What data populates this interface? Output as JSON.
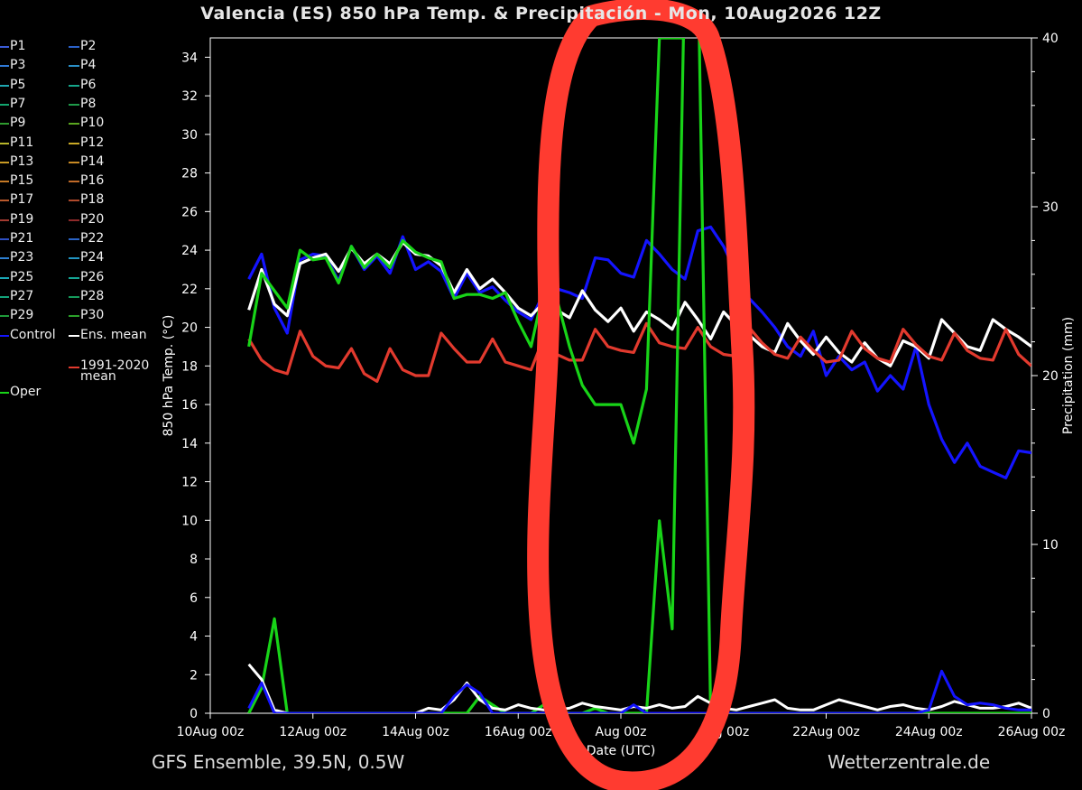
{
  "title": "Valencia  (ES)  850 hPa Temp. & Precipitación - Mon, 10Aug2026 12Z",
  "footer_left": "GFS Ensemble, 39.5N, 0.5W",
  "footer_right": "Wetterzentrale.de",
  "legend": [
    {
      "label": "P1",
      "color": "#3b5bd6"
    },
    {
      "label": "P2",
      "color": "#2b61c8"
    },
    {
      "label": "P3",
      "color": "#2f7ad8"
    },
    {
      "label": "P4",
      "color": "#2a8fc7"
    },
    {
      "label": "P5",
      "color": "#1fa6b0"
    },
    {
      "label": "P6",
      "color": "#16a58a"
    },
    {
      "label": "P7",
      "color": "#12a56e"
    },
    {
      "label": "P8",
      "color": "#1f9a4a"
    },
    {
      "label": "P9",
      "color": "#2f9b2f"
    },
    {
      "label": "P10",
      "color": "#5aa51f"
    },
    {
      "label": "P11",
      "color": "#b7b52a"
    },
    {
      "label": "P12",
      "color": "#c9a926"
    },
    {
      "label": "P13",
      "color": "#c89a24"
    },
    {
      "label": "P14",
      "color": "#c88a24"
    },
    {
      "label": "P15",
      "color": "#c57a26"
    },
    {
      "label": "P16",
      "color": "#c06a28"
    },
    {
      "label": "P17",
      "color": "#b9592c"
    },
    {
      "label": "P18",
      "color": "#b04a2c"
    },
    {
      "label": "P19",
      "color": "#a23a30"
    },
    {
      "label": "P20",
      "color": "#8e2a2a"
    },
    {
      "label": "P21",
      "color": "#2e4fc2"
    },
    {
      "label": "P22",
      "color": "#2a64c6"
    },
    {
      "label": "P23",
      "color": "#2d7fd0"
    },
    {
      "label": "P24",
      "color": "#2295c2"
    },
    {
      "label": "P25",
      "color": "#1aa7b6"
    },
    {
      "label": "P26",
      "color": "#15a595"
    },
    {
      "label": "P27",
      "color": "#13a37a"
    },
    {
      "label": "P28",
      "color": "#159a5c"
    },
    {
      "label": "P29",
      "color": "#1f9a3a"
    },
    {
      "label": "P30",
      "color": "#2ba12a"
    },
    {
      "label": "Control",
      "color": "#1414ff"
    },
    {
      "label": "Ens. mean",
      "color": "#ffffff"
    },
    {
      "label": "1991-2020",
      "label2": "mean",
      "color": "#e23a2e"
    },
    {
      "label": "Oper",
      "color": "#18d418"
    }
  ],
  "annotation": {
    "color": "#ff3b30"
  },
  "chart_data": {
    "type": "line",
    "title": "Valencia  (ES)  850 hPa Temp. & Precipitación - Mon, 10Aug2026 12Z",
    "xlabel": "Date (UTC)",
    "ylabel": "850 hPa Temp. (°C)",
    "y2label": "Precipitation (mm)",
    "ylim": [
      0,
      35
    ],
    "y2lim": [
      0,
      40
    ],
    "y_ticks": [
      0,
      2,
      4,
      6,
      8,
      10,
      12,
      14,
      16,
      18,
      20,
      22,
      24,
      26,
      28,
      30,
      32,
      34
    ],
    "y2_ticks": [
      0,
      10,
      20,
      30,
      40
    ],
    "x_ticks": [
      {
        "label": "10Aug 00z",
        "day": 0
      },
      {
        "label": "12Aug 00z",
        "day": 2
      },
      {
        "label": "14Aug 00z",
        "day": 4
      },
      {
        "label": "16Aug 00z",
        "day": 6
      },
      {
        "label": "Aug 00z",
        "day": 8
      },
      {
        "label": "Aug 00z",
        "day": 10
      },
      {
        "label": "22Aug 00z",
        "day": 12
      },
      {
        "label": "24Aug 00z",
        "day": 14
      },
      {
        "label": "26Aug 00z",
        "day": 16
      }
    ],
    "xlim": [
      0,
      16
    ],
    "x_days": [
      0.75,
      1.0,
      1.25,
      1.5,
      1.75,
      2.0,
      2.25,
      2.5,
      2.75,
      3.0,
      3.25,
      3.5,
      3.75,
      4.0,
      4.25,
      4.5,
      4.75,
      5.0,
      5.25,
      5.5,
      5.75,
      6.0,
      6.25,
      6.5,
      6.75,
      7.0,
      7.25,
      7.5,
      7.75,
      8.0,
      8.25,
      8.5,
      8.75,
      9.0,
      9.25,
      9.5,
      9.75,
      10.0,
      10.25,
      10.5,
      10.75,
      11.0,
      11.25,
      11.5,
      11.75,
      12.0,
      12.25,
      12.5,
      12.75,
      13.0,
      13.25,
      13.5,
      13.75,
      14.0,
      14.25,
      14.5,
      14.75,
      15.0,
      15.25,
      15.5,
      15.75,
      16.0
    ],
    "series": [
      {
        "name": "Control",
        "kind": "temp",
        "color": "#1414ff",
        "width": 3.2,
        "values": [
          22.5,
          23.8,
          21.0,
          19.7,
          23.5,
          23.8,
          23.7,
          22.4,
          24.2,
          23.0,
          23.7,
          22.8,
          24.7,
          23.0,
          23.4,
          22.9,
          21.5,
          22.8,
          21.8,
          22.1,
          21.4,
          20.8,
          20.4,
          21.8,
          22.0,
          21.8,
          21.5,
          23.6,
          23.5,
          22.8,
          22.6,
          24.5,
          23.8,
          23.0,
          22.5,
          25.0,
          25.2,
          24.2,
          22.8,
          21.5,
          20.8,
          20.0,
          19.0,
          18.5,
          19.8,
          17.5,
          18.5,
          17.8,
          18.2,
          16.7,
          17.5,
          16.8,
          19.0,
          16.0,
          14.2,
          13.0,
          14.0,
          12.8,
          12.5,
          12.2,
          13.6,
          13.5,
          12.6,
          14.5
        ]
      },
      {
        "name": "Ens. mean",
        "kind": "temp",
        "color": "#ffffff",
        "width": 3.2,
        "values": [
          20.9,
          23.0,
          21.2,
          20.6,
          23.3,
          23.6,
          23.8,
          22.9,
          24.1,
          23.3,
          23.8,
          23.3,
          24.4,
          23.8,
          23.7,
          23.2,
          21.8,
          23.0,
          22.0,
          22.5,
          21.8,
          21.0,
          20.6,
          21.3,
          20.9,
          20.5,
          21.9,
          20.9,
          20.3,
          21.0,
          19.8,
          20.8,
          20.4,
          19.9,
          21.3,
          20.4,
          19.4,
          20.8,
          20.1,
          19.6,
          19.0,
          18.7,
          20.2,
          19.3,
          18.6,
          19.5,
          18.7,
          18.2,
          19.2,
          18.4,
          18.0,
          19.3,
          19.0,
          18.4,
          20.4,
          19.7,
          19.0,
          18.8,
          20.4,
          19.9,
          19.5,
          19.0
        ]
      },
      {
        "name": "1991-2020 mean",
        "kind": "temp",
        "color": "#e23a2e",
        "width": 3.2,
        "values": [
          19.4,
          18.3,
          17.8,
          17.6,
          19.8,
          18.5,
          18.0,
          17.9,
          18.9,
          17.6,
          17.2,
          18.9,
          17.8,
          17.5,
          17.5,
          19.7,
          18.9,
          18.2,
          18.2,
          19.4,
          18.2,
          18.0,
          17.8,
          19.5,
          18.6,
          18.3,
          18.3,
          19.9,
          19.0,
          18.8,
          18.7,
          20.2,
          19.2,
          19.0,
          18.9,
          20.0,
          19.0,
          18.6,
          18.5,
          20.0,
          19.2,
          18.6,
          18.4,
          19.5,
          18.8,
          18.2,
          18.3,
          19.8,
          18.9,
          18.4,
          18.2,
          19.9,
          19.1,
          18.5,
          18.3,
          19.7,
          18.8,
          18.4,
          18.3,
          19.9,
          18.6,
          18.0,
          17.9,
          18.0
        ]
      },
      {
        "name": "Oper",
        "kind": "temp",
        "color": "#18d418",
        "width": 3.2,
        "values": [
          19.0,
          22.8,
          21.9,
          21.0,
          24.0,
          23.5,
          23.6,
          22.3,
          24.2,
          23.1,
          23.8,
          23.1,
          24.5,
          23.9,
          23.6,
          23.4,
          21.5,
          21.7,
          21.7,
          21.5,
          21.8,
          20.3,
          19.0,
          22.0,
          21.5,
          19.0,
          17.0,
          16.0,
          16.0,
          16.0,
          14.0,
          16.8,
          35.0,
          35.0,
          35.0
        ]
      },
      {
        "name": "Oper",
        "kind": "precip",
        "color": "#18d418",
        "width": 3.2,
        "values": [
          0,
          1.5,
          5.6,
          0,
          0,
          0,
          0,
          0,
          0,
          0,
          0,
          0,
          0,
          0,
          0,
          0,
          0,
          0,
          1.0,
          0.5,
          0,
          0,
          0,
          0.5,
          0.2,
          0,
          0,
          0.3,
          0,
          0,
          0,
          0,
          11.4,
          5.0,
          45.0,
          45.0,
          0,
          0,
          0,
          0,
          0,
          0,
          0,
          0,
          0,
          0,
          0,
          0,
          0,
          0,
          0,
          0,
          0,
          0,
          0,
          0,
          0,
          0,
          0,
          0,
          0,
          0,
          0,
          0
        ]
      },
      {
        "name": "Ens. mean",
        "kind": "precip",
        "color": "#ffffff",
        "width": 3,
        "values": [
          2.9,
          2.0,
          0.2,
          0,
          0,
          0,
          0,
          0,
          0,
          0,
          0,
          0,
          0,
          0,
          0.3,
          0.2,
          0.8,
          1.8,
          0.8,
          0.3,
          0.2,
          0.5,
          0.3,
          0.2,
          0.2,
          0.3,
          0.6,
          0.4,
          0.3,
          0.2,
          0.4,
          0.3,
          0.5,
          0.3,
          0.4,
          1.0,
          0.6,
          0.3,
          0.2,
          0.4,
          0.6,
          0.8,
          0.3,
          0.2,
          0.2,
          0.5,
          0.8,
          0.6,
          0.4,
          0.2,
          0.4,
          0.5,
          0.3,
          0.2,
          0.4,
          0.7,
          0.5,
          0.3,
          0.3,
          0.4,
          0.6,
          0.3,
          0.2,
          0.1
        ]
      },
      {
        "name": "Control",
        "kind": "precip",
        "color": "#1414ff",
        "width": 3,
        "values": [
          0.3,
          1.8,
          0,
          0,
          0,
          0,
          0,
          0,
          0,
          0,
          0,
          0,
          0,
          0,
          0,
          0,
          1.0,
          1.7,
          1.2,
          0,
          0,
          0,
          0,
          0,
          0,
          0,
          0,
          0,
          0,
          0,
          0.5,
          0,
          0,
          0,
          0,
          0,
          0,
          0,
          0,
          0,
          0,
          0,
          0,
          0,
          0,
          0,
          0,
          0,
          0,
          0,
          0,
          0,
          0,
          0.2,
          2.5,
          1.0,
          0.5,
          0.6,
          0.5,
          0.3,
          0.2,
          0.2,
          0.1,
          0
        ]
      }
    ]
  }
}
